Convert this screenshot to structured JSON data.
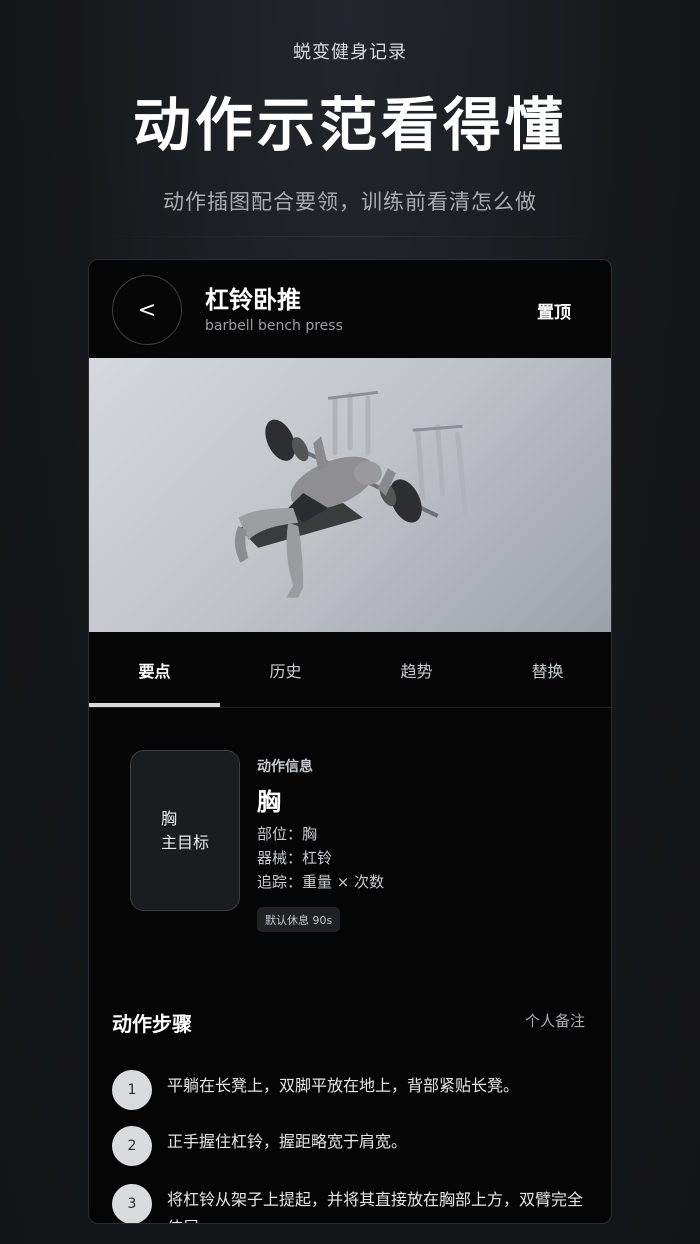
{
  "promo": {
    "app_name": "蜕变健身记录",
    "headline": "动作示范看得懂",
    "description": "动作插图配合要领，训练前看清怎么做"
  },
  "header": {
    "back_icon": "chevron-left-icon",
    "back_glyph": "<",
    "exercise_name": "杠铃卧推",
    "exercise_name_en": "barbell bench press",
    "pin_label": "置顶"
  },
  "tabs": [
    {
      "label": "要点",
      "active": true
    },
    {
      "label": "历史",
      "active": false
    },
    {
      "label": "趋势",
      "active": false
    },
    {
      "label": "替换",
      "active": false
    }
  ],
  "muscle_card": {
    "muscle": "胸",
    "role": "主目标"
  },
  "info": {
    "section_label": "动作信息",
    "muscle": "胸",
    "body_part": "部位：胸",
    "equipment": "器械：杠铃",
    "tracking": "追踪：重量 × 次数",
    "rest": "默认休息 90s"
  },
  "steps": {
    "title": "动作步骤",
    "notes_label": "个人备注",
    "items": [
      {
        "num": "1",
        "text": "平躺在长凳上，双脚平放在地上，背部紧贴长凳。"
      },
      {
        "num": "2",
        "text": "正手握住杠铃，握距略宽于肩宽。"
      },
      {
        "num": "3",
        "text": "将杠铃从架子上提起，并将其直接放在胸部上方，双臂完全伸展。"
      }
    ]
  },
  "colors": {
    "accent": "#d8dadc",
    "background": "#050505"
  }
}
